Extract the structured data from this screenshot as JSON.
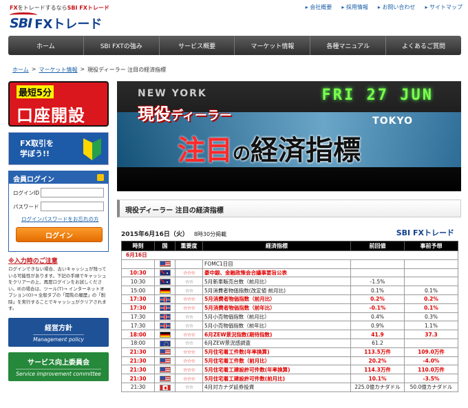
{
  "header": {
    "tagline_pre": "FX",
    "tagline_mid": "をトレードするなら",
    "tagline_brand": "SBI FXトレード",
    "logo_sbi": "SBI",
    "logo_fx": "FXトレード",
    "util_links": [
      "会社概要",
      "採用情報",
      "お問い合わせ",
      "サイトマップ"
    ]
  },
  "nav": [
    "ホーム",
    "SBI FXTの強み",
    "サービス概要",
    "マーケット情報",
    "各種マニュアル",
    "よくあるご質問"
  ],
  "breadcrumb": {
    "home": "ホーム",
    "sep1": ">",
    "market": "マーケット情報",
    "sep2": ">",
    "current": "現役ディーラー 注目の経済指標"
  },
  "sidebar": {
    "open_top": "最短5分",
    "open_big": "口座開設",
    "learn_line1": "FX取引を",
    "learn_line2": "学ぼう!!",
    "login_title": "会員ログイン",
    "login_id_label": "ログインID",
    "password_label": "パスワード",
    "forgot_link": "ログインパスワードをお忘れの方",
    "login_button": "ログイン",
    "notice_title": "※入力時のご注意",
    "notice_body": "ログインできない場合、古いキャッシュが残っている可能性があります。下記の手順でキャッシュをクリアーの上、再度ログインをお試しください。IEの場合は、ツール(T)→ インターネットオプション(O)→ 全般タブの「閲覧の履歴」の「削除」を実行することでキャッシュがクリアされます。",
    "btn1_jp": "経営方針",
    "btn1_en": "Management policy",
    "btn2_jp": "サービス向上委員会",
    "btn2_en": "Service improvement committee"
  },
  "hero": {
    "ticker": "FRI 27 JUN",
    "city1": "NEW YORK",
    "city2": "TOKYO",
    "sub_a": "現役",
    "sub_b": "ディーラー",
    "main_a": "注目",
    "main_b": "の",
    "main_c": "経済指標"
  },
  "section_title": "現役ディーラー 注目の経済指標",
  "table_header": {
    "date": "2015年6月16日（火）",
    "time": "8時30分掲載",
    "logo_sbi": "SBI",
    "logo_fx": "FXトレード"
  },
  "table": {
    "columns": [
      "時刻",
      "国",
      "重要度",
      "経済指標",
      "前回値",
      "事前予想"
    ],
    "date_row": "6月16日",
    "rows": [
      {
        "time": "",
        "flag": "us",
        "stars": "",
        "name": "FOMC1日目",
        "prev": "",
        "fcst": "",
        "imp": false
      },
      {
        "time": "10:30",
        "flag": "au",
        "stars": "☆☆☆",
        "name": "豪中銀、金融政策会合議事要旨公表",
        "prev": "",
        "fcst": "",
        "imp": true
      },
      {
        "time": "10:30",
        "flag": "au",
        "stars": "☆☆",
        "name": "5月新車販売台数（前月比）",
        "prev": "-1.5%",
        "fcst": "",
        "imp": false
      },
      {
        "time": "15:00",
        "flag": "de",
        "stars": "☆☆",
        "name": "5月消費者物価指数(改定値 前月比)",
        "prev": "0.1%",
        "fcst": "0.1%",
        "imp": false
      },
      {
        "time": "17:30",
        "flag": "gb",
        "stars": "☆☆☆",
        "name": "5月消費者物価指数（前月比）",
        "prev": "0.2%",
        "fcst": "0.2%",
        "imp": true
      },
      {
        "time": "17:30",
        "flag": "gb",
        "stars": "☆☆☆",
        "name": "5月消費者物価指数（前年比）",
        "prev": "-0.1%",
        "fcst": "0.1%",
        "imp": true
      },
      {
        "time": "17:30",
        "flag": "gb",
        "stars": "☆☆",
        "name": "5月小売物価指数（前月比）",
        "prev": "0.4%",
        "fcst": "0.3%",
        "imp": false
      },
      {
        "time": "17:30",
        "flag": "gb",
        "stars": "☆☆",
        "name": "5月小売物価指数（前年比）",
        "prev": "0.9%",
        "fcst": "1.1%",
        "imp": false
      },
      {
        "time": "18:00",
        "flag": "de",
        "stars": "☆☆☆",
        "name": "6月ZEW景況指数(期待指数)",
        "prev": "41.9",
        "fcst": "37.3",
        "imp": true
      },
      {
        "time": "18:00",
        "flag": "eu",
        "stars": "☆☆",
        "name": "6月ZEW景況感調査",
        "prev": "61.2",
        "fcst": "",
        "imp": false
      },
      {
        "time": "21:30",
        "flag": "us",
        "stars": "☆☆☆",
        "name": "5月住宅着工件数(年率換算)",
        "prev": "113.5万件",
        "fcst": "109.0万件",
        "imp": true
      },
      {
        "time": "21:30",
        "flag": "us",
        "stars": "☆☆☆",
        "name": "5月住宅着工件数（前月比）",
        "prev": "20.2%",
        "fcst": "-4.0%",
        "imp": true
      },
      {
        "time": "21:30",
        "flag": "us",
        "stars": "☆☆☆",
        "name": "5月住宅着工建設許可件数(年率換算)",
        "prev": "114.3万件",
        "fcst": "110.0万件",
        "imp": true
      },
      {
        "time": "21:30",
        "flag": "us",
        "stars": "☆☆☆",
        "name": "5月住宅着工建設許可件数(前月比)",
        "prev": "10.1%",
        "fcst": "-3.5%",
        "imp": true
      },
      {
        "time": "21:30",
        "flag": "ca",
        "stars": "☆☆",
        "name": "4月対カナダ証券投資",
        "prev": "225.0億カナダドル",
        "fcst": "50.0億カナダドル",
        "imp": false
      }
    ]
  }
}
